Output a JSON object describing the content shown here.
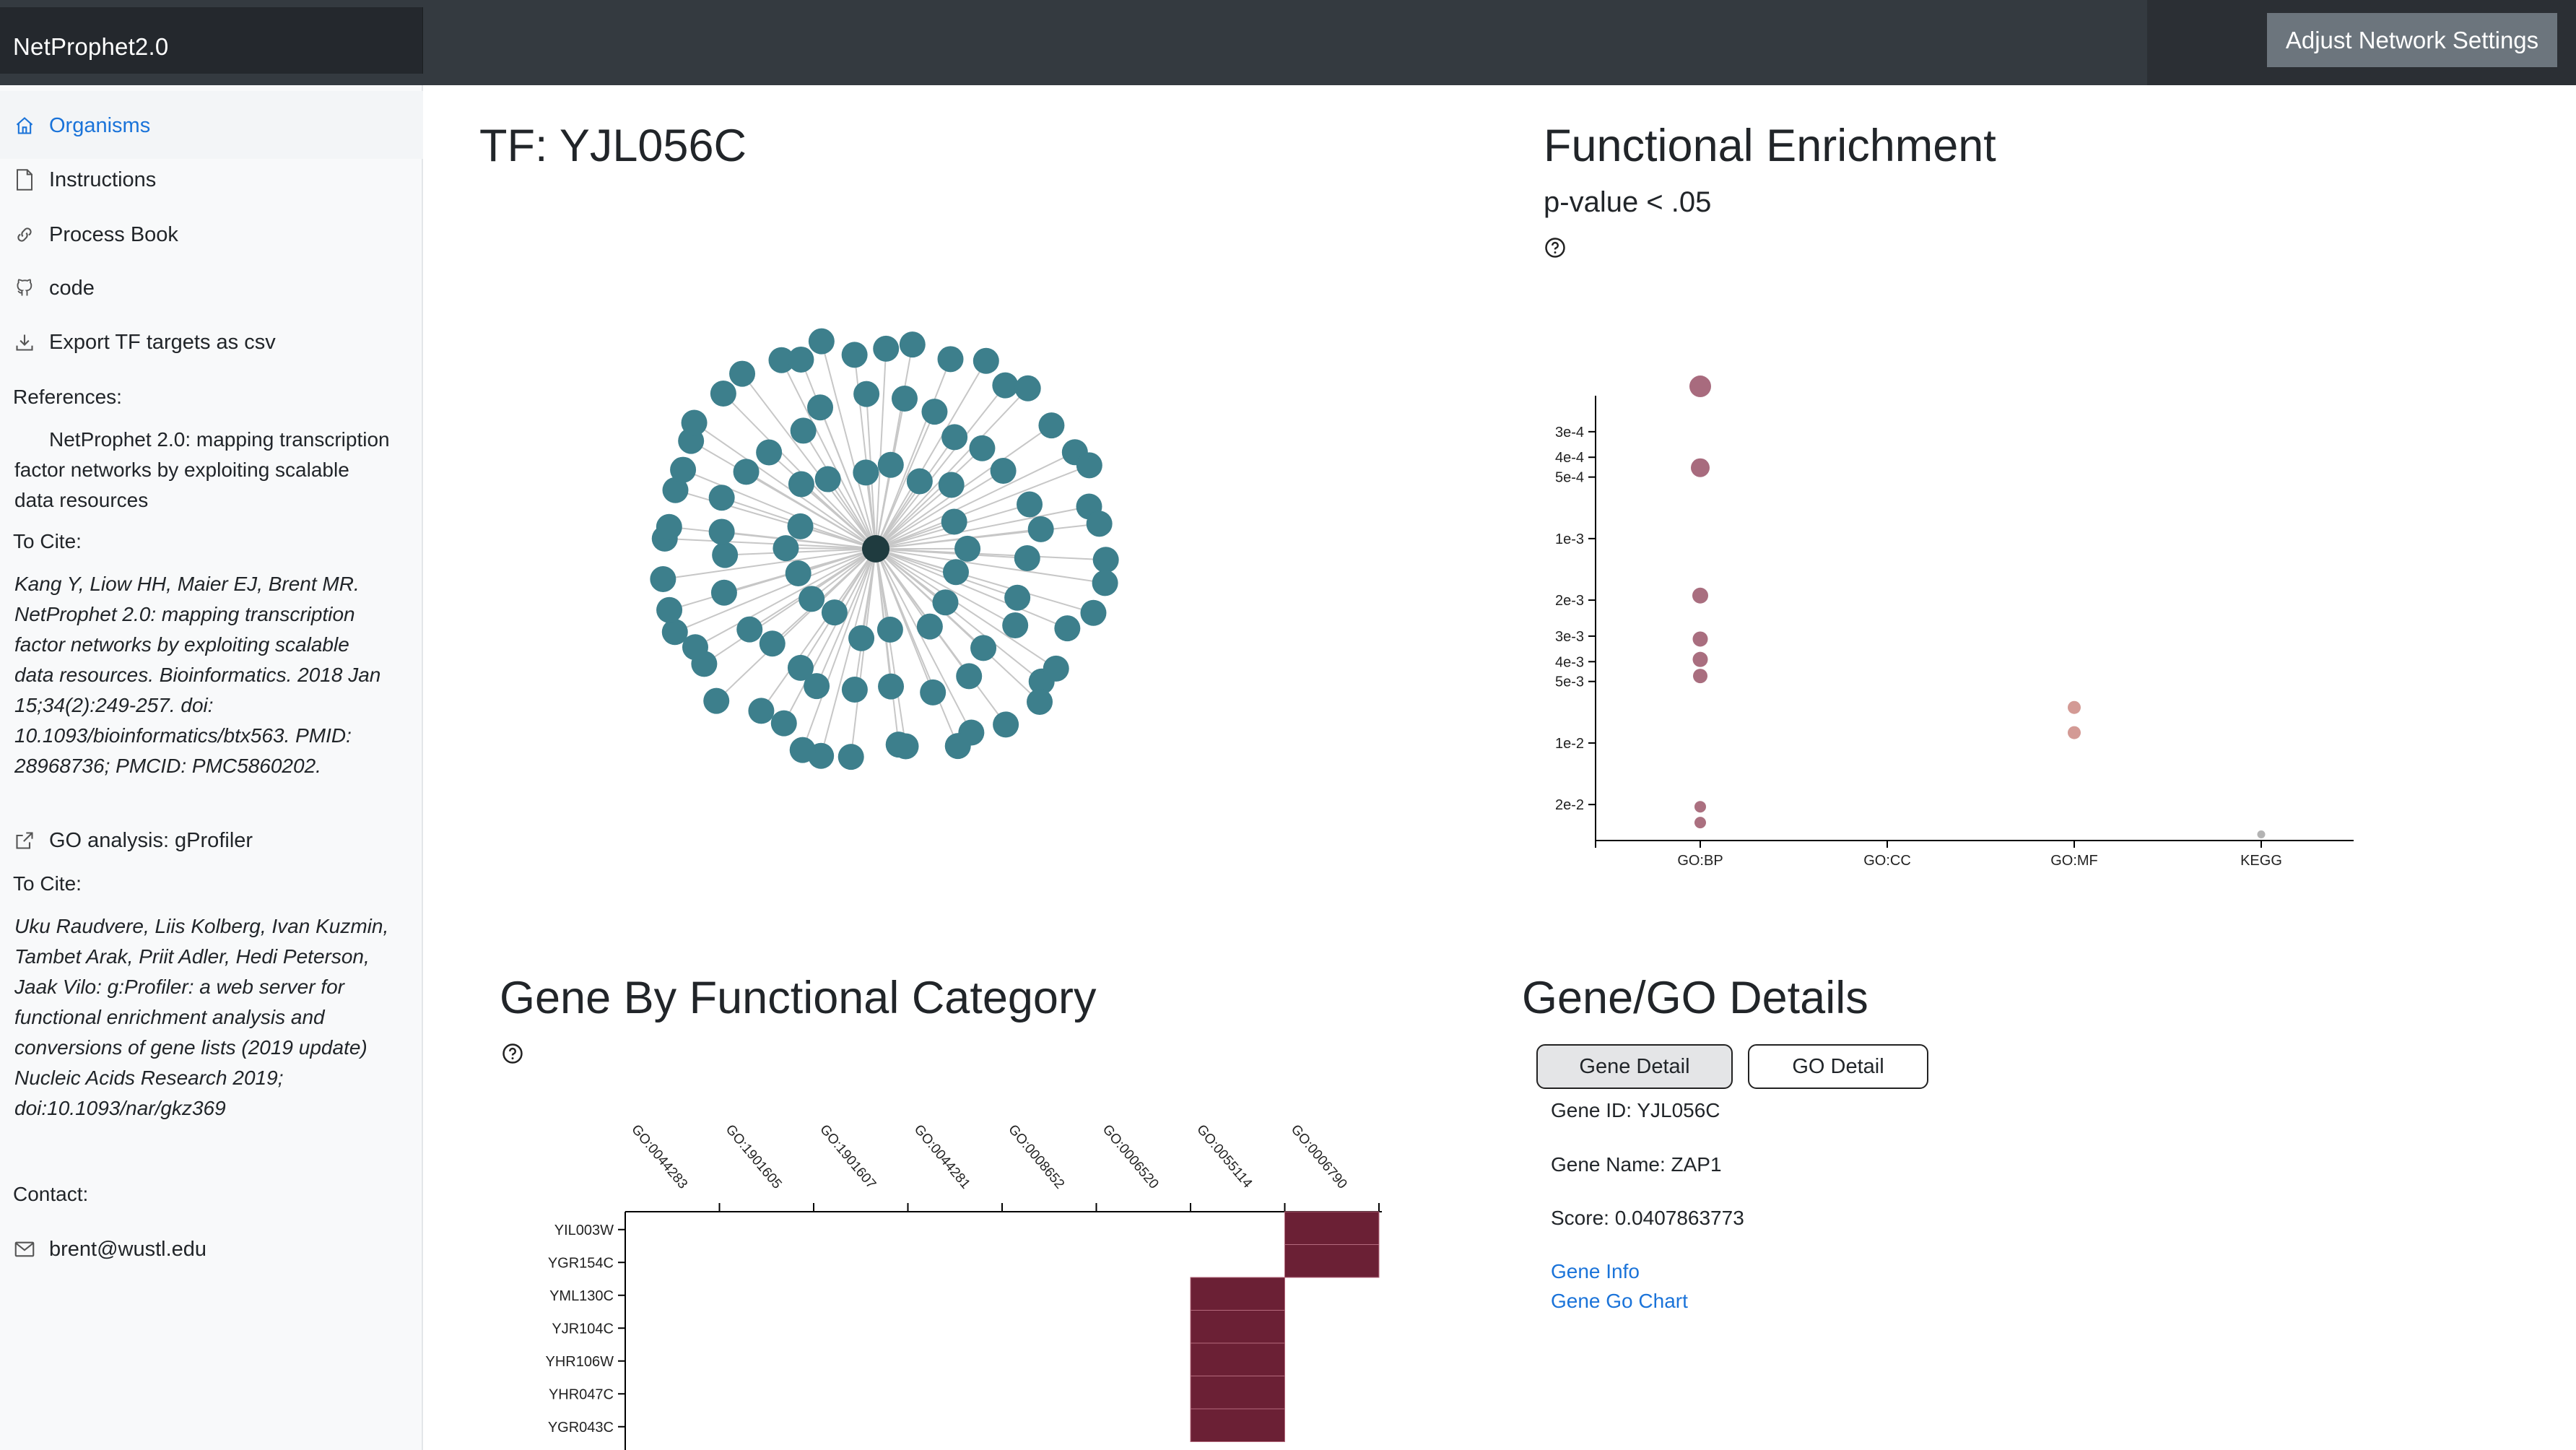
{
  "navbar": {
    "brand": "NetProphet2.0",
    "settings_button": "Adjust Network Settings"
  },
  "sidebar": {
    "nav_items": [
      {
        "label": "Organisms",
        "icon": "home-icon"
      },
      {
        "label": "Instructions",
        "icon": "file-icon"
      },
      {
        "label": "Process Book",
        "icon": "link-icon"
      },
      {
        "label": "code",
        "icon": "github-icon"
      },
      {
        "label": "Export TF targets as csv",
        "icon": "download-icon"
      }
    ],
    "references_label": "References:",
    "reference_1": "NetProphet 2.0: mapping transcription factor networks by exploiting scalable data resources",
    "to_cite_label_1": "To Cite:",
    "citation_1": "Kang Y, Liow HH, Maier EJ, Brent MR. NetProphet 2.0: mapping transcription factor networks by exploiting scalable data resources. Bioinformatics. 2018 Jan 15;34(2):249-257. doi: 10.1093/bioinformatics/btx563. PMID: 28968736; PMCID: PMC5860202.",
    "reference_2": "GO analysis: gProfiler",
    "to_cite_label_2": "To Cite:",
    "citation_2": "Uku Raudvere, Liis Kolberg, Ivan Kuzmin, Tambet Arak, Priit Adler, Hedi Peterson, Jaak Vilo: g:Profiler: a web server for functional enrichment analysis and conversions of gene lists (2019 update) Nucleic Acids Research 2019; doi:10.1093/nar/gkz369",
    "contact_label": "Contact:",
    "contact_email": "brent@wustl.edu"
  },
  "network_panel": {
    "title": "TF: YJL056C",
    "target_count": 92,
    "node_color": "#3d7f8c",
    "center_color": "#1f3b3f"
  },
  "enrichment_panel": {
    "title": "Functional Enrichment",
    "subtitle": "p-value < .05"
  },
  "chart_data": {
    "type": "scatter",
    "x_categories": [
      "GO:BP",
      "GO:CC",
      "GO:MF",
      "KEGG"
    ],
    "y_scale": "log",
    "y_ticks": [
      "3e-4",
      "4e-4",
      "5e-4",
      "1e-3",
      "2e-3",
      "3e-3",
      "4e-3",
      "5e-3",
      "1e-2",
      "2e-2"
    ],
    "y_tick_values": [
      0.0003,
      0.0004,
      0.0005,
      0.001,
      0.002,
      0.003,
      0.004,
      0.005,
      0.01,
      0.02
    ],
    "ylim": [
      0.0002,
      0.03
    ],
    "points": [
      {
        "x": "GO:BP",
        "y": 0.00018,
        "size": 3,
        "color": "#a86b7e"
      },
      {
        "x": "GO:BP",
        "y": 0.00045,
        "size": 2.6,
        "color": "#a86b7e"
      },
      {
        "x": "GO:BP",
        "y": 0.0019,
        "size": 2.2,
        "color": "#a96e7f"
      },
      {
        "x": "GO:BP",
        "y": 0.0031,
        "size": 2.1,
        "color": "#a96e7f"
      },
      {
        "x": "GO:BP",
        "y": 0.0039,
        "size": 2.1,
        "color": "#a96e7f"
      },
      {
        "x": "GO:BP",
        "y": 0.0047,
        "size": 2,
        "color": "#a96e7f"
      },
      {
        "x": "GO:BP",
        "y": 0.0205,
        "size": 1.6,
        "color": "#ab7080"
      },
      {
        "x": "GO:BP",
        "y": 0.0245,
        "size": 1.6,
        "color": "#ab7080"
      },
      {
        "x": "GO:MF",
        "y": 0.0067,
        "size": 1.8,
        "color": "#d39a95"
      },
      {
        "x": "GO:MF",
        "y": 0.0089,
        "size": 1.8,
        "color": "#d39a95"
      },
      {
        "x": "KEGG",
        "y": 0.028,
        "size": 1.1,
        "color": "#b3b3b3"
      }
    ]
  },
  "heatmap_panel": {
    "title": "Gene By Functional Category",
    "columns": [
      "GO:0044283",
      "GO:1901605",
      "GO:1901607",
      "GO:0044281",
      "GO:0008652",
      "GO:0006520",
      "GO:0055114",
      "GO:0006790"
    ],
    "rows": [
      "YIL003W",
      "YGR154C",
      "YML130C",
      "YJR104C",
      "YHR106W",
      "YHR047C",
      "YGR043C"
    ],
    "filled": [
      {
        "row": "YIL003W",
        "col": "GO:0006790"
      },
      {
        "row": "YGR154C",
        "col": "GO:0006790"
      },
      {
        "row": "YML130C",
        "col": "GO:0055114"
      },
      {
        "row": "YJR104C",
        "col": "GO:0055114"
      },
      {
        "row": "YHR106W",
        "col": "GO:0055114"
      },
      {
        "row": "YHR047C",
        "col": "GO:0055114"
      },
      {
        "row": "YGR043C",
        "col": "GO:0055114"
      }
    ],
    "fill_color": "#6b2035"
  },
  "details_panel": {
    "title": "Gene/GO Details",
    "tab_gene": "Gene Detail",
    "tab_go": "GO Detail",
    "gene_id": "Gene ID: YJL056C",
    "gene_name": "Gene Name: ZAP1",
    "score": "Score: 0.0407863773",
    "link_info": "Gene Info",
    "link_chart": "Gene Go Chart"
  }
}
